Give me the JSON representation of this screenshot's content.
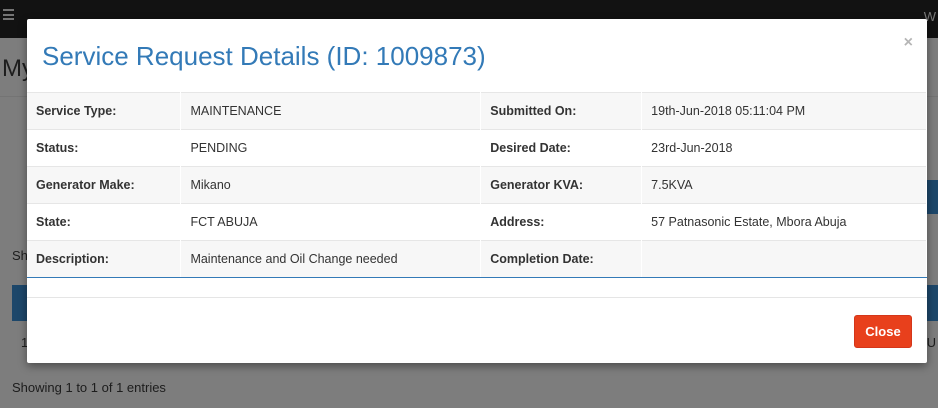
{
  "background": {
    "topbar_right": "W",
    "page_title": "My",
    "show_label": "Sh",
    "row_cell": "1",
    "right_cell": "BU",
    "footer": "Showing 1 to 1 of 1 entries"
  },
  "modal": {
    "title": "Service Request Details (ID: 1009873)",
    "close_x": "×",
    "rows": [
      {
        "label1": "Service Type:",
        "value1": "MAINTENANCE",
        "label2": "Submitted On:",
        "value2": "19th-Jun-2018 05:11:04 PM"
      },
      {
        "label1": "Status:",
        "value1": "PENDING",
        "label2": "Desired Date:",
        "value2": "23rd-Jun-2018"
      },
      {
        "label1": "Generator Make:",
        "value1": "Mikano",
        "label2": "Generator KVA:",
        "value2": "7.5KVA"
      },
      {
        "label1": "State:",
        "value1": "FCT ABUJA",
        "label2": "Address:",
        "value2": "57 Patnasonic Estate, Mbora Abuja"
      },
      {
        "label1": "Description:",
        "value1": "Maintenance and Oil Change needed",
        "label2": "Completion Date:",
        "value2": ""
      }
    ],
    "close_button": "Close"
  },
  "colors": {
    "accent": "#337ab7",
    "danger": "#e8401c"
  }
}
